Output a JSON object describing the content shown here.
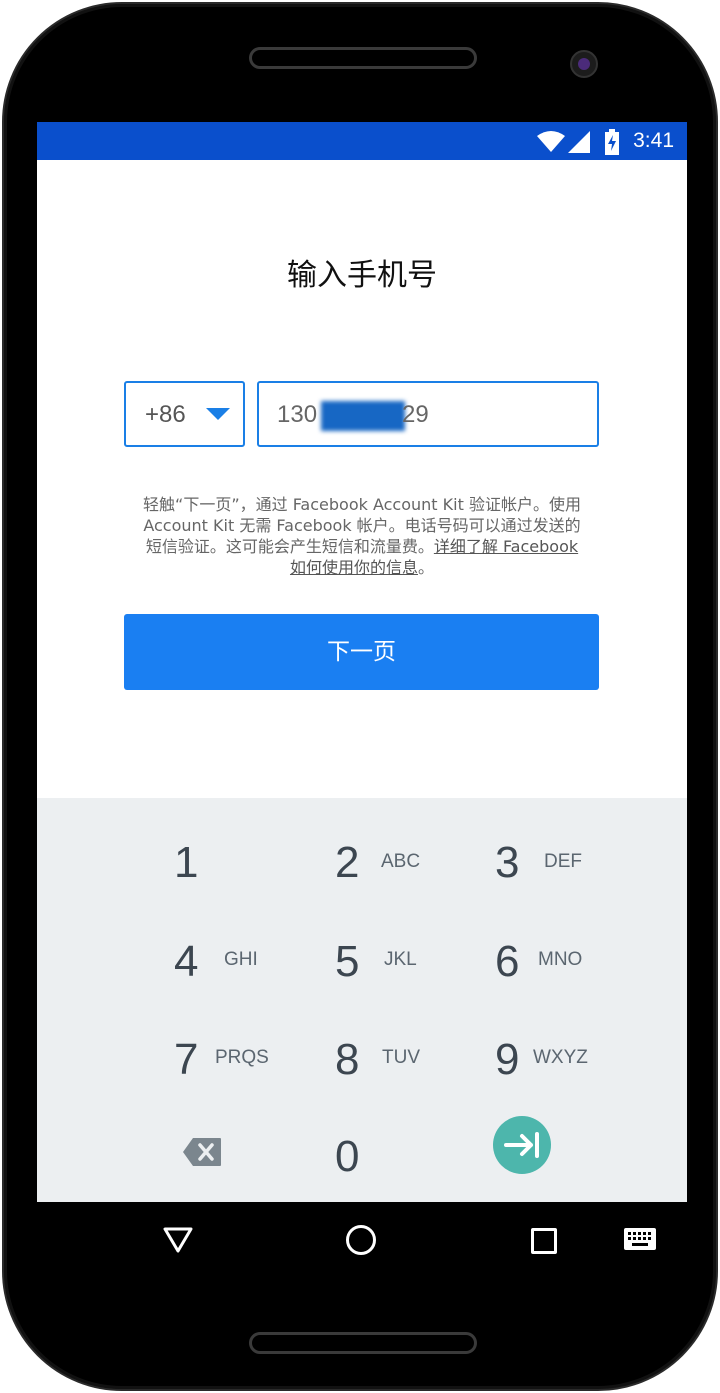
{
  "status_bar": {
    "time": "3:41",
    "icons": [
      "wifi-icon",
      "signal-icon",
      "battery-charging-icon"
    ],
    "color": "#0a4fcc"
  },
  "screen": {
    "title": "输入手机号",
    "country_code": "+86",
    "phone_prefix": "130",
    "phone_suffix": "29",
    "disclaimer": {
      "line1": "轻触“下一页”，通过 Facebook Account Kit 验证帐户。使用",
      "line2": "Account Kit 无需 Facebook 帐户。电话号码可以通过发送的",
      "line3_text": "短信验证。这可能会产生短信和流量费。",
      "line3_link": "详细了解 Facebook",
      "line4_link": "如何使用你的信息",
      "line4_end": "。"
    },
    "next_button": "下一页",
    "accent_color": "#1a7ff2"
  },
  "keypad": {
    "keys": [
      {
        "digit": "1",
        "letters": ""
      },
      {
        "digit": "2",
        "letters": "ABC"
      },
      {
        "digit": "3",
        "letters": "DEF"
      },
      {
        "digit": "4",
        "letters": "GHI"
      },
      {
        "digit": "5",
        "letters": "JKL"
      },
      {
        "digit": "6",
        "letters": "MNO"
      },
      {
        "digit": "7",
        "letters": "PRQS"
      },
      {
        "digit": "8",
        "letters": "TUV"
      },
      {
        "digit": "9",
        "letters": "WXYZ"
      },
      {
        "digit": "0",
        "letters": ""
      }
    ],
    "action_icons": [
      "backspace-icon",
      "next-field-icon"
    ],
    "action_color": "#4db6ac"
  },
  "nav_bar": {
    "icons": [
      "back-icon",
      "home-icon",
      "recents-icon",
      "keyboard-icon"
    ]
  }
}
